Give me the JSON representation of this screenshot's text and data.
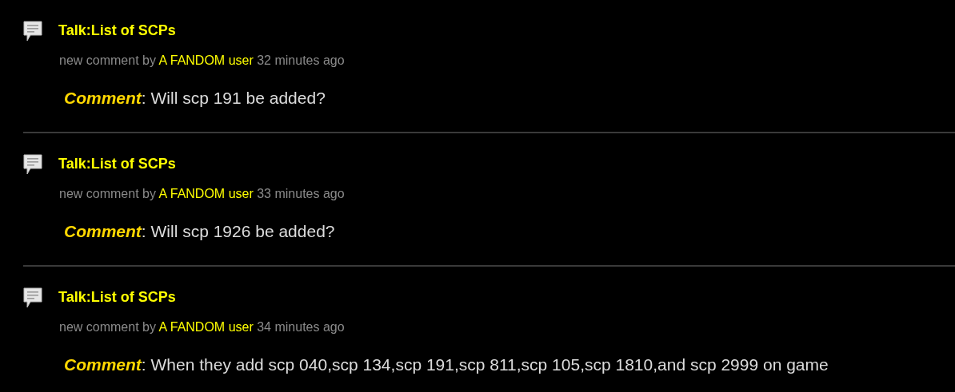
{
  "entries": [
    {
      "title": "Talk:List of SCPs",
      "meta_prefix": "new comment by",
      "user": "A FANDOM user",
      "time": "32 minutes ago",
      "comment_label": "Comment",
      "comment_text": ": Will scp 191 be added?"
    },
    {
      "title": "Talk:List of SCPs",
      "meta_prefix": "new comment by",
      "user": "A FANDOM user",
      "time": "33 minutes ago",
      "comment_label": "Comment",
      "comment_text": ": Will scp 1926 be added?"
    },
    {
      "title": "Talk:List of SCPs",
      "meta_prefix": "new comment by",
      "user": "A FANDOM user",
      "time": "34 minutes ago",
      "comment_label": "Comment",
      "comment_text": ": When they add scp 040,scp 134,scp 191,scp 811,scp 105,scp 1810,and scp 2999 on game"
    }
  ]
}
